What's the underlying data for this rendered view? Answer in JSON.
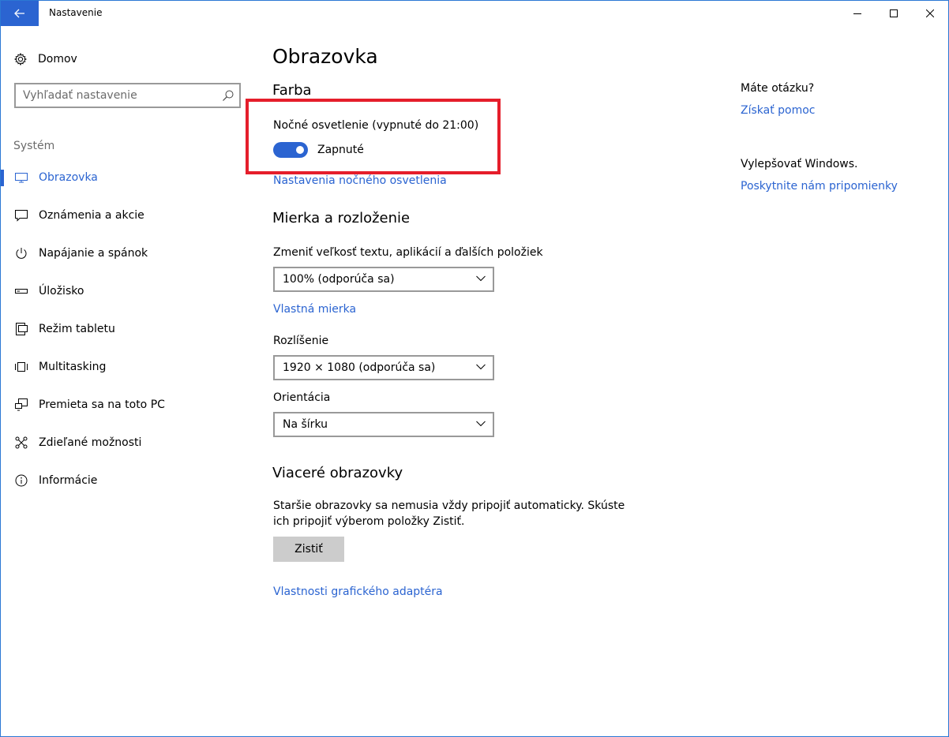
{
  "window": {
    "title": "Nastavenie",
    "accent_color": "#2b64d1",
    "highlight_color": "#e51e2b"
  },
  "titlebar": {
    "back_icon": "back-arrow-icon",
    "controls": [
      "minimize-icon",
      "maximize-icon",
      "close-icon"
    ]
  },
  "sidebar": {
    "home_label": "Domov",
    "search_placeholder": "Vyhľadať nastavenie",
    "section_label": "Systém",
    "items": [
      {
        "label": "Obrazovka",
        "icon": "monitor-icon",
        "active": true
      },
      {
        "label": "Oznámenia a akcie",
        "icon": "notification-icon",
        "active": false
      },
      {
        "label": "Napájanie a spánok",
        "icon": "power-icon",
        "active": false
      },
      {
        "label": "Úložisko",
        "icon": "storage-icon",
        "active": false
      },
      {
        "label": "Režim tabletu",
        "icon": "tablet-icon",
        "active": false
      },
      {
        "label": "Multitasking",
        "icon": "multitasking-icon",
        "active": false
      },
      {
        "label": "Premieta sa na toto PC",
        "icon": "projecting-icon",
        "active": false
      },
      {
        "label": "Zdieľané možnosti",
        "icon": "shared-experiences-icon",
        "active": false
      },
      {
        "label": "Informácie",
        "icon": "info-icon",
        "active": false
      }
    ]
  },
  "main": {
    "title": "Obrazovka",
    "color_section": {
      "heading": "Farba",
      "night_light_label": "Nočné osvetlenie (vypnuté do 21:00)",
      "toggle_state": "Zapnuté",
      "toggle_on": true,
      "settings_link": "Nastavenia nočného osvetlenia"
    },
    "scale_section": {
      "heading": "Mierka a rozloženie",
      "scale_label": "Zmeniť veľkosť textu, aplikácií a ďalších položiek",
      "scale_value": "100% (odporúča sa)",
      "custom_scale_link": "Vlastná mierka",
      "resolution_label": "Rozlíšenie",
      "resolution_value": "1920 × 1080 (odporúča sa)",
      "orientation_label": "Orientácia",
      "orientation_value": "Na šírku"
    },
    "multi_section": {
      "heading": "Viaceré obrazovky",
      "description": "Staršie obrazovky sa nemusia vždy pripojiť automaticky. Skúste ich pripojiť výberom položky Zistiť.",
      "detect_button": "Zistiť",
      "adapter_link": "Vlastnosti grafického adaptéra"
    }
  },
  "right": {
    "question": "Máte otázku?",
    "help_link": "Získať pomoc",
    "improve": "Vylepšovať Windows.",
    "feedback_link": "Poskytnite nám pripomienky"
  }
}
